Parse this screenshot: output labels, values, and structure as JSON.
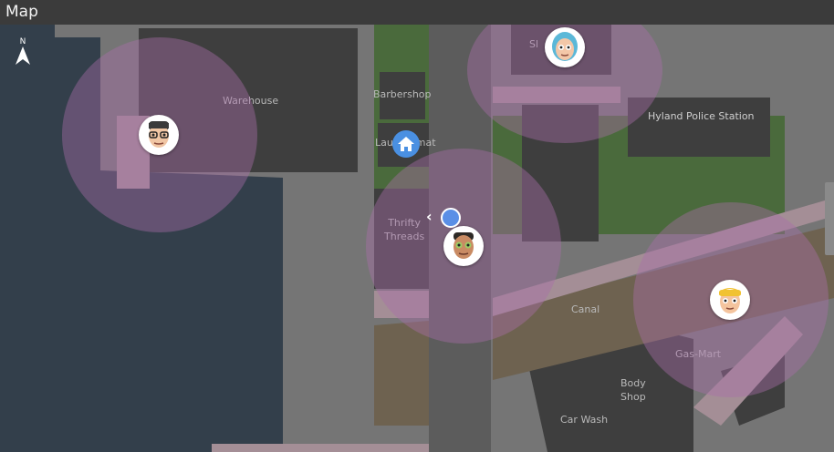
{
  "window": {
    "title": "Map"
  },
  "compass": {
    "label": "N",
    "icon": "north-arrow-icon"
  },
  "places": {
    "warehouse": "Warehouse",
    "barbershop": "Barbershop",
    "laundromat": "Laundromat",
    "thrifty_threads_line1": "Thrifty",
    "thrifty_threads_line2": "Threads",
    "police": "Hyland Police Station",
    "canal": "Canal",
    "gas_mart": "Gas-Mart",
    "body_shop_line1": "Body",
    "body_shop_line2": "Shop",
    "car_wash": "Car Wash",
    "top_partial": "Sl"
  },
  "markers": {
    "home": {
      "icon": "home-icon",
      "color": "#4a90e2"
    },
    "player": {
      "icon": "player-location-icon",
      "color": "#5a8fe6"
    },
    "characters": [
      {
        "name": "character-glasses",
        "skin": "#f1c6a4",
        "hair": "#3b3b3b"
      },
      {
        "name": "character-blue-hair",
        "skin": "#f3c7a8",
        "hair": "#5bb8d8"
      },
      {
        "name": "character-green-eyes",
        "skin": "#c98b63",
        "hair": "#2e2a26"
      },
      {
        "name": "character-blonde",
        "skin": "#f4c49e",
        "hair": "#f1c232"
      }
    ]
  },
  "colors": {
    "water": "#333f4b",
    "ground": "#757575",
    "building": "#3e3e3e",
    "grass": "#4a6a3c",
    "path": "#a48e96",
    "dirt": "#6e6250",
    "zone": "#aa6eaa"
  }
}
